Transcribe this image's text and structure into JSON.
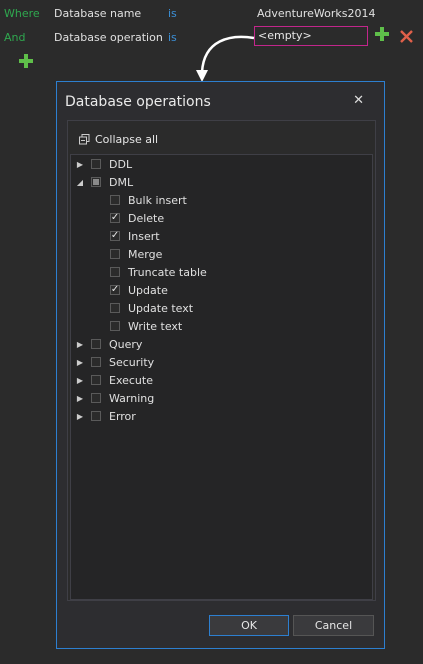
{
  "filter": {
    "row1": {
      "keyword": "Where",
      "field": "Database name",
      "op": "is",
      "value": "AdventureWorks2014"
    },
    "row2": {
      "keyword": "And",
      "field": "Database operation",
      "op": "is",
      "value": "<empty>"
    }
  },
  "icons": {
    "add": "plus-icon",
    "remove": "close-x-icon"
  },
  "colors": {
    "keyword_green": "#2fa84f",
    "keyword_blue": "#3b8fd6",
    "accent": "#2d7fd0",
    "value_border": "#c2268b",
    "remove": "#e0604a"
  },
  "dialog": {
    "title": "Database operations",
    "close": "✕",
    "collapse_all": "Collapse all",
    "tree": [
      {
        "label": "DDL",
        "expanded": false,
        "state": "unchecked"
      },
      {
        "label": "DML",
        "expanded": true,
        "state": "partial",
        "children": [
          {
            "label": "Bulk insert",
            "checked": false
          },
          {
            "label": "Delete",
            "checked": true
          },
          {
            "label": "Insert",
            "checked": true
          },
          {
            "label": "Merge",
            "checked": false
          },
          {
            "label": "Truncate table",
            "checked": false
          },
          {
            "label": "Update",
            "checked": true
          },
          {
            "label": "Update text",
            "checked": false
          },
          {
            "label": "Write text",
            "checked": false
          }
        ]
      },
      {
        "label": "Query",
        "expanded": false,
        "state": "unchecked"
      },
      {
        "label": "Security",
        "expanded": false,
        "state": "unchecked"
      },
      {
        "label": "Execute",
        "expanded": false,
        "state": "unchecked"
      },
      {
        "label": "Warning",
        "expanded": false,
        "state": "unchecked"
      },
      {
        "label": "Error",
        "expanded": false,
        "state": "unchecked"
      }
    ],
    "ok": "OK",
    "cancel": "Cancel"
  }
}
